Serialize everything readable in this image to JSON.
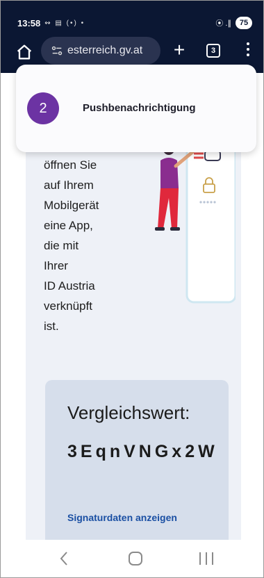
{
  "status_bar": {
    "time": "13:58",
    "small_icons": "↭ ▤ (•) •",
    "signal": "⦿ .∥",
    "battery": "75"
  },
  "browser": {
    "url": "esterreich.gv.at",
    "new_tab": "+",
    "tab_count": "3"
  },
  "step": {
    "number": "2",
    "label": "Pushbenachrichtigung"
  },
  "instructions": {
    "lines": [
      "öffnen Sie",
      "auf Ihrem",
      "Mobilgerät",
      "eine App,",
      "die mit",
      "Ihrer",
      "ID Austria",
      "verknüpft",
      "ist."
    ]
  },
  "compare": {
    "label": "Vergleichswert:",
    "value": "3EqnVNGx2W",
    "link": "Signaturdaten anzeigen"
  },
  "colors": {
    "top_bar": "#0b1733",
    "step_badge": "#6c33a3",
    "link": "#1a4fa3",
    "card": "#d6deeb",
    "panel": "#eef1f7"
  },
  "icons": [
    "home-icon",
    "site-settings-icon",
    "new-tab-icon",
    "tab-switcher-icon",
    "overflow-menu-icon",
    "back-icon",
    "home-nav-icon",
    "recents-icon"
  ]
}
